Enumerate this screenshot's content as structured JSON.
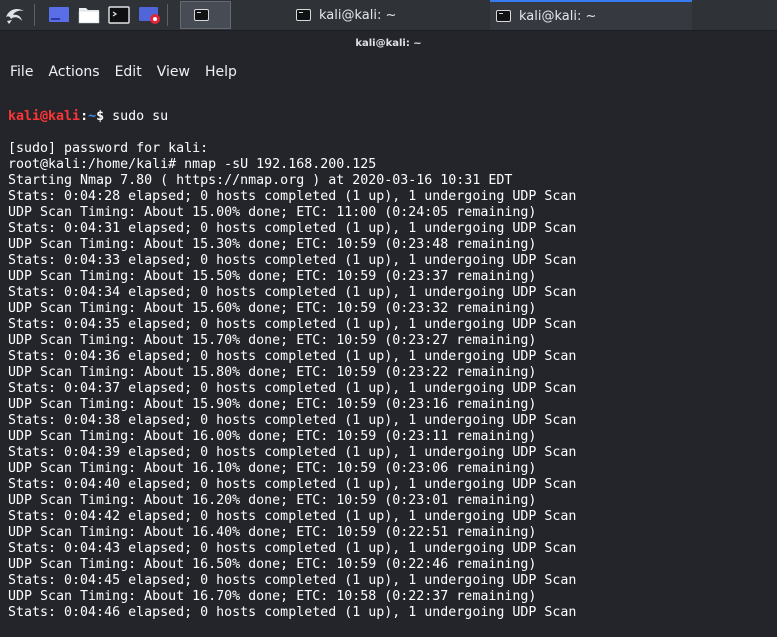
{
  "taskbar": {
    "apps": [
      {
        "name": "kali-menu-icon"
      },
      {
        "name": "show-desktop-icon"
      },
      {
        "name": "file-manager-icon"
      },
      {
        "name": "terminal-launcher-icon"
      },
      {
        "name": "screen-recorder-icon"
      }
    ],
    "active_task_label": "",
    "tasks": [
      {
        "label": "kali@kali: ~"
      },
      {
        "label": "kali@kali: ~"
      }
    ],
    "accent_color": "#367bf0"
  },
  "window": {
    "title": "kali@kali: ~"
  },
  "menu": [
    "File",
    "Actions",
    "Edit",
    "View",
    "Help"
  ],
  "terminal": {
    "prompt": {
      "user": "kali@kali",
      "sep": ":",
      "path": "~",
      "symbol": "$ ",
      "command": "sudo su"
    },
    "lines": [
      "[sudo] password for kali:",
      "root@kali:/home/kali# nmap -sU 192.168.200.125",
      "Starting Nmap 7.80 ( https://nmap.org ) at 2020-03-16 10:31 EDT",
      "Stats: 0:04:28 elapsed; 0 hosts completed (1 up), 1 undergoing UDP Scan",
      "UDP Scan Timing: About 15.00% done; ETC: 11:00 (0:24:05 remaining)",
      "Stats: 0:04:31 elapsed; 0 hosts completed (1 up), 1 undergoing UDP Scan",
      "UDP Scan Timing: About 15.30% done; ETC: 10:59 (0:23:48 remaining)",
      "Stats: 0:04:33 elapsed; 0 hosts completed (1 up), 1 undergoing UDP Scan",
      "UDP Scan Timing: About 15.50% done; ETC: 10:59 (0:23:37 remaining)",
      "Stats: 0:04:34 elapsed; 0 hosts completed (1 up), 1 undergoing UDP Scan",
      "UDP Scan Timing: About 15.60% done; ETC: 10:59 (0:23:32 remaining)",
      "Stats: 0:04:35 elapsed; 0 hosts completed (1 up), 1 undergoing UDP Scan",
      "UDP Scan Timing: About 15.70% done; ETC: 10:59 (0:23:27 remaining)",
      "Stats: 0:04:36 elapsed; 0 hosts completed (1 up), 1 undergoing UDP Scan",
      "UDP Scan Timing: About 15.80% done; ETC: 10:59 (0:23:22 remaining)",
      "Stats: 0:04:37 elapsed; 0 hosts completed (1 up), 1 undergoing UDP Scan",
      "UDP Scan Timing: About 15.90% done; ETC: 10:59 (0:23:16 remaining)",
      "Stats: 0:04:38 elapsed; 0 hosts completed (1 up), 1 undergoing UDP Scan",
      "UDP Scan Timing: About 16.00% done; ETC: 10:59 (0:23:11 remaining)",
      "Stats: 0:04:39 elapsed; 0 hosts completed (1 up), 1 undergoing UDP Scan",
      "UDP Scan Timing: About 16.10% done; ETC: 10:59 (0:23:06 remaining)",
      "Stats: 0:04:40 elapsed; 0 hosts completed (1 up), 1 undergoing UDP Scan",
      "UDP Scan Timing: About 16.20% done; ETC: 10:59 (0:23:01 remaining)",
      "Stats: 0:04:42 elapsed; 0 hosts completed (1 up), 1 undergoing UDP Scan",
      "UDP Scan Timing: About 16.40% done; ETC: 10:59 (0:22:51 remaining)",
      "Stats: 0:04:43 elapsed; 0 hosts completed (1 up), 1 undergoing UDP Scan",
      "UDP Scan Timing: About 16.50% done; ETC: 10:59 (0:22:46 remaining)",
      "Stats: 0:04:45 elapsed; 0 hosts completed (1 up), 1 undergoing UDP Scan",
      "UDP Scan Timing: About 16.70% done; ETC: 10:58 (0:22:37 remaining)",
      "Stats: 0:04:46 elapsed; 0 hosts completed (1 up), 1 undergoing UDP Scan"
    ],
    "colors": {
      "background": "#23252b",
      "text": "#ffffff",
      "prompt_user": "#ff3434",
      "prompt_path": "#3b8eea"
    }
  }
}
